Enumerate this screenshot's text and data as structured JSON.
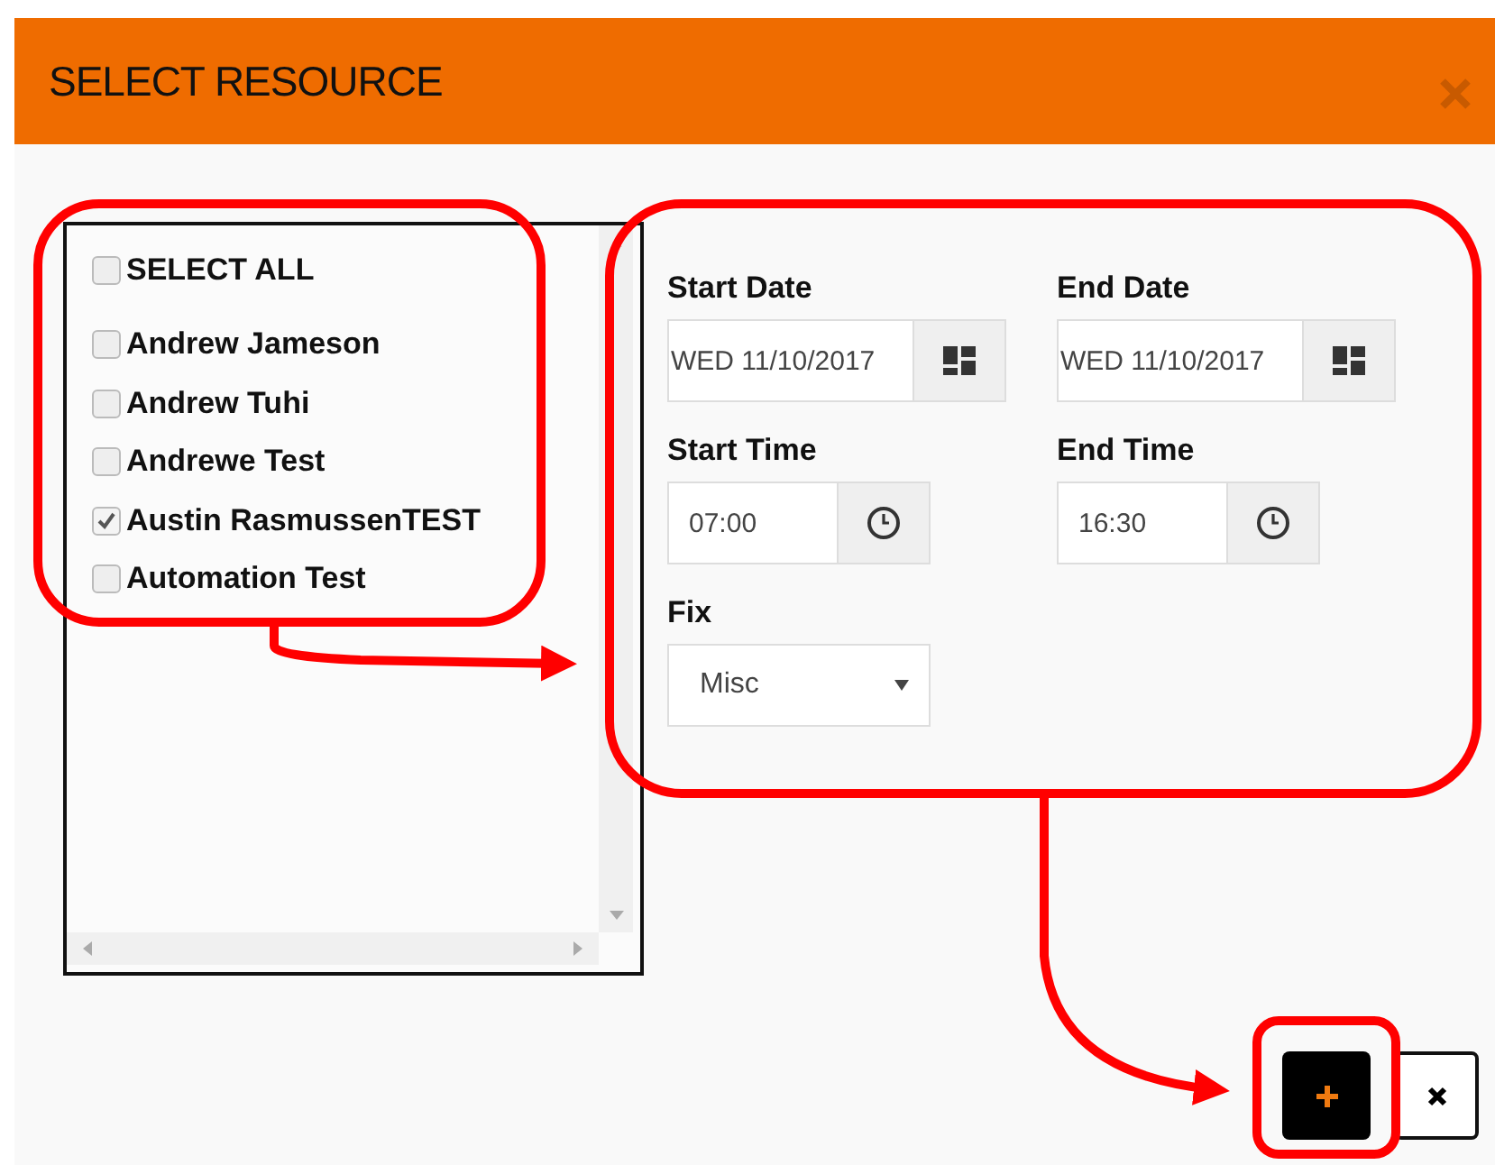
{
  "dialog": {
    "title": "SELECT RESOURCE"
  },
  "resource_list": {
    "select_all": {
      "label": "SELECT ALL",
      "checked": false
    },
    "items": [
      {
        "label": "Andrew Jameson",
        "checked": false
      },
      {
        "label": "Andrew Tuhi",
        "checked": false
      },
      {
        "label": "Andrewe Test",
        "checked": false
      },
      {
        "label": "Austin RasmussenTEST",
        "checked": true
      },
      {
        "label": "Automation Test",
        "checked": false
      }
    ]
  },
  "form": {
    "fields": [
      {
        "kind": "date",
        "label": "Start Date",
        "value": "WED 11/10/2017"
      },
      {
        "kind": "date",
        "label": "End Date",
        "value": "WED 11/10/2017"
      },
      {
        "kind": "time",
        "label": "Start Time",
        "value": "07:00"
      },
      {
        "kind": "time",
        "label": "End Time",
        "value": "16:30"
      },
      {
        "kind": "select",
        "label": "Fix",
        "value": "Misc"
      }
    ]
  },
  "buttons": [
    {
      "kind": "add"
    },
    {
      "kind": "cancel"
    }
  ]
}
